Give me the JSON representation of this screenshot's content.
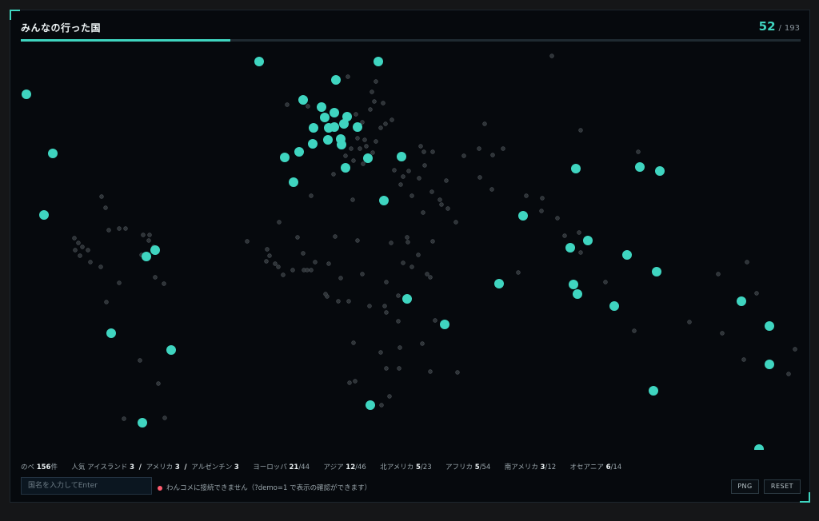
{
  "header": {
    "title": "みんなの行った国",
    "visited_count": "52",
    "separator": "/",
    "total_count": "193",
    "progress_fraction": 0.269
  },
  "colors": {
    "accent": "#3fd5c0",
    "unvisited": "#2e3337",
    "background": "#06090d",
    "error": "#ff5b6e"
  },
  "footer": {
    "total_label": "のべ",
    "total_value": "156",
    "total_unit": "件",
    "popular_label": "人気",
    "popular": [
      {
        "name": "アイスランド",
        "count": "3"
      },
      {
        "name": "アメリカ",
        "count": "3"
      },
      {
        "name": "アルゼンチン",
        "count": "3"
      }
    ],
    "regions": [
      {
        "name": "ヨーロッパ",
        "visited": "21",
        "total": "/44"
      },
      {
        "name": "アジア",
        "visited": "12",
        "total": "/46"
      },
      {
        "name": "北アメリカ",
        "visited": "5",
        "total": "/23"
      },
      {
        "name": "アフリカ",
        "visited": "5",
        "total": "/54"
      },
      {
        "name": "南アメリカ",
        "visited": "3",
        "total": "/12"
      },
      {
        "name": "オセアニア",
        "visited": "6",
        "total": "/14"
      }
    ],
    "input_placeholder": "国名を入力してEnter",
    "status_text": "わんコメに接続できません（?demo=1 で表示の確認ができます）",
    "png_label": "PNG",
    "reset_label": "RESET"
  }
}
